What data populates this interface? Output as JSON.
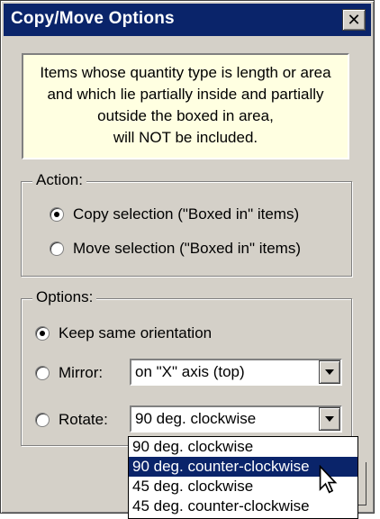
{
  "dialog": {
    "title": "Copy/Move Options",
    "close_glyph": "✕"
  },
  "notice": {
    "lines": [
      "Items whose quantity type is length or area",
      "and which lie partially inside and partially",
      "outside the boxed in area,",
      "will NOT be included."
    ]
  },
  "action_group": {
    "legend": "Action:",
    "options": [
      {
        "label": "Copy selection (\"Boxed in\" items)",
        "checked": true
      },
      {
        "label": "Move selection (\"Boxed in\" items)",
        "checked": false
      }
    ]
  },
  "options_group": {
    "legend": "Options:",
    "keep_orientation": {
      "label": "Keep same orientation",
      "checked": true
    },
    "mirror": {
      "label": "Mirror:",
      "checked": false,
      "value": "on \"X\" axis (top)"
    },
    "rotate": {
      "label": "Rotate:",
      "checked": false,
      "value": "90 deg. clockwise"
    }
  },
  "rotate_dropdown": {
    "items": [
      "90 deg. clockwise",
      "90 deg. counter-clockwise",
      "45 deg. clockwise",
      "45 deg. counter-clockwise"
    ],
    "highlighted_index": 1
  },
  "icons": {
    "close": "close-icon",
    "dropdown_arrow": "chevron-down-icon",
    "cursor": "mouse-pointer-icon"
  },
  "colors": {
    "titlebar": "#0a246a",
    "dialog_face": "#d4d0c8",
    "notice_bg": "#ffffe1",
    "selection": "#0a246a"
  }
}
